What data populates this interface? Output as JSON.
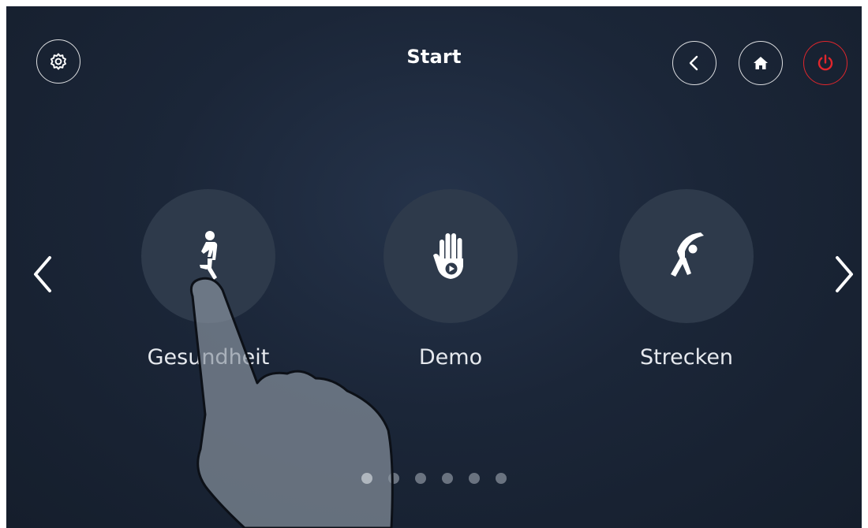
{
  "header": {
    "title": "Start",
    "settings_icon": "gear-icon",
    "back_icon": "chevron-left-icon",
    "home_icon": "home-icon",
    "power_icon": "power-icon",
    "power_color": "#e0262c"
  },
  "carousel": {
    "prev_icon": "chevron-left-icon",
    "next_icon": "chevron-right-icon",
    "tiles": [
      {
        "label": "Gesundheit",
        "icon": "walking-person-icon"
      },
      {
        "label": "Demo",
        "icon": "hand-play-icon"
      },
      {
        "label": "Strecken",
        "icon": "stretching-person-icon"
      }
    ],
    "page_count": 6,
    "active_page": 1
  },
  "overlay": {
    "icon": "pointing-hand-icon"
  },
  "colors": {
    "background": "#1b2638",
    "tile": "#2e3a4b",
    "dot_inactive": "#6a7380",
    "dot_active": "#ffffff"
  }
}
